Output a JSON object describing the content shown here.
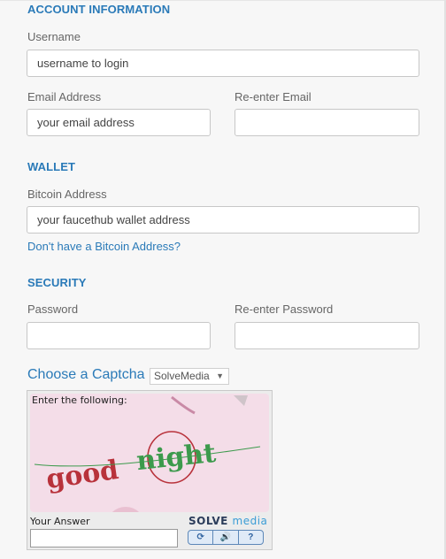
{
  "sections": {
    "account": "ACCOUNT INFORMATION",
    "wallet": "WALLET",
    "security": "SECURITY"
  },
  "fields": {
    "username": {
      "label": "Username",
      "value": "username to login"
    },
    "email": {
      "label": "Email Address",
      "value": "your email address"
    },
    "email_confirm": {
      "label": "Re-enter Email",
      "value": ""
    },
    "bitcoin": {
      "label": "Bitcoin Address",
      "value": "your faucethub wallet address"
    },
    "password": {
      "label": "Password",
      "value": ""
    },
    "password_confirm": {
      "label": "Re-enter Password",
      "value": ""
    }
  },
  "links": {
    "no_bitcoin": "Don't have a Bitcoin Address?"
  },
  "captcha": {
    "heading": "Choose a Captcha",
    "provider_selected": "SolveMedia",
    "prompt": "Enter the following:",
    "image_text": "good night",
    "answer_label": "Your Answer",
    "brand_solve": "SOLVE",
    "brand_media": "media",
    "buttons": {
      "refresh": "⟳",
      "audio": "🔊",
      "help": "?"
    }
  },
  "colors": {
    "accent": "#2a7ab8",
    "captcha_bg": "#f3dbe6",
    "captcha_red": "#b8323b",
    "captcha_green": "#3c9a4c"
  }
}
